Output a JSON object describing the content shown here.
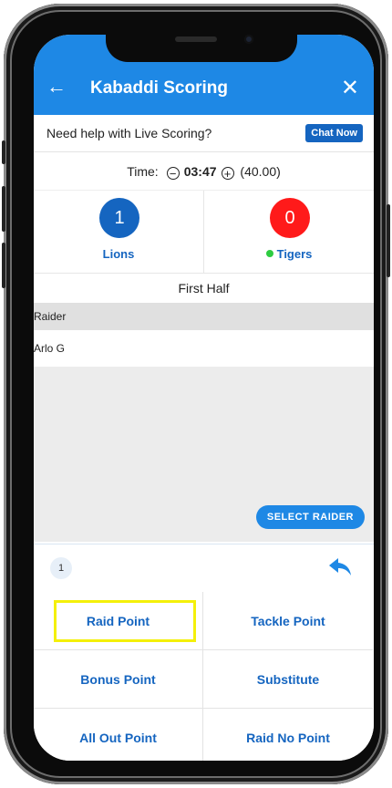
{
  "appbar": {
    "title": "Kabaddi Scoring",
    "back_icon": "arrow-left-icon",
    "close_icon": "close-icon"
  },
  "help": {
    "text": "Need help with Live Scoring?",
    "chat_label": "Chat Now"
  },
  "timer": {
    "label": "Time:",
    "time": "03:47",
    "total": "(40.00)"
  },
  "teams": [
    {
      "name": "Lions",
      "score": "1",
      "color": "#1565c0"
    },
    {
      "name": "Tigers",
      "score": "0",
      "color": "#ff1a1a",
      "active_dot": "#2ecc40"
    }
  ],
  "period": "First Half",
  "raider": {
    "header": "Raider",
    "name": "Arlo G",
    "select_label": "SELECT RAIDER"
  },
  "strip": {
    "count": "1",
    "undo_icon": "undo-icon"
  },
  "actions": [
    {
      "label": "Raid Point",
      "highlighted": true
    },
    {
      "label": "Tackle Point"
    },
    {
      "label": "Bonus Point"
    },
    {
      "label": "Substitute"
    },
    {
      "label": "All Out Point"
    },
    {
      "label": "Raid No Point"
    }
  ],
  "colors": {
    "primary": "#1e88e5",
    "accent": "#1565c0",
    "highlight": "#f4f00a"
  }
}
